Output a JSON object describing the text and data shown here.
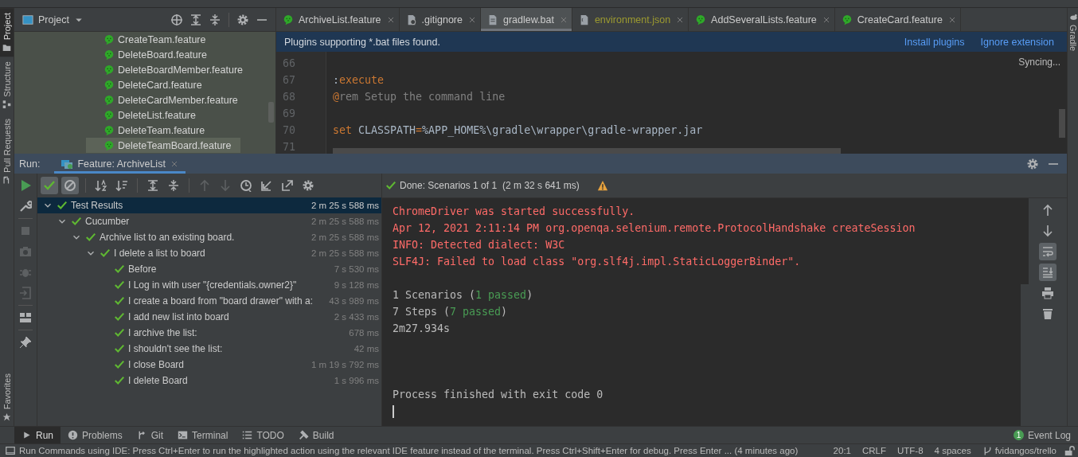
{
  "left_tool_strip": [
    {
      "label": "Project",
      "selected": true
    },
    {
      "label": "Structure",
      "selected": false
    },
    {
      "label": "Pull Requests",
      "selected": false
    },
    {
      "label": "Favorites",
      "selected": false
    }
  ],
  "project_panel": {
    "title": "Project",
    "items": [
      {
        "label": "CreateTeam.feature",
        "selected": false
      },
      {
        "label": "DeleteBoard.feature",
        "selected": false
      },
      {
        "label": "DeleteBoardMember.feature",
        "selected": false
      },
      {
        "label": "DeleteCard.feature",
        "selected": false
      },
      {
        "label": "DeleteCardMember.feature",
        "selected": false
      },
      {
        "label": "DeleteList.feature",
        "selected": false
      },
      {
        "label": "DeleteTeam.feature",
        "selected": false
      },
      {
        "label": "DeleteTeamBoard.feature",
        "selected": true
      }
    ]
  },
  "editor_tabs": [
    {
      "label": "ArchiveList.feature",
      "kind": "cucumber",
      "selected": false,
      "modified": false
    },
    {
      "label": ".gitignore",
      "kind": "ignore",
      "selected": false,
      "modified": false
    },
    {
      "label": "gradlew.bat",
      "kind": "file",
      "selected": true,
      "modified": false
    },
    {
      "label": "environment.json",
      "kind": "json",
      "selected": false,
      "modified": true
    },
    {
      "label": "AddSeveralLists.feature",
      "kind": "cucumber",
      "selected": false,
      "modified": false
    },
    {
      "label": "CreateCard.feature",
      "kind": "cucumber",
      "selected": false,
      "modified": false
    }
  ],
  "notification": {
    "text": "Plugins supporting *.bat files found.",
    "actions": [
      "Install plugins",
      "Ignore extension"
    ]
  },
  "right_tool_strip": {
    "label": "Gradle"
  },
  "editor": {
    "status": "Syncing...",
    "lines": [
      {
        "number": "66"
      },
      {
        "number": "67",
        "code": [
          {
            "text": ":",
            "kind": "plain"
          },
          {
            "text": "execute",
            "kind": "keyword"
          }
        ]
      },
      {
        "number": "68",
        "code": [
          {
            "text": "@",
            "kind": "keyword"
          },
          {
            "text": "rem Setup the command line",
            "kind": "comment"
          }
        ]
      },
      {
        "number": "69"
      },
      {
        "number": "70",
        "code": [
          {
            "text": "set",
            "kind": "keyword"
          },
          {
            "text": " CLASSPATH",
            "kind": "plain"
          },
          {
            "text": "=",
            "kind": "keyword"
          },
          {
            "text": "%APP_HOME%\\gradle\\wrapper\\gradle-wrapper.jar",
            "kind": "plain"
          }
        ]
      },
      {
        "number": "71"
      }
    ]
  },
  "run_panel": {
    "label": "Run:",
    "tabs": [
      {
        "label": "Feature: ArchiveList",
        "selected": true
      }
    ],
    "tree_toggles": [
      {
        "kind": "passed",
        "selected": true
      },
      {
        "kind": "ignored",
        "selected": true
      }
    ],
    "status": {
      "text": "Done: Scenarios 1 of 1",
      "duration": "(2 m 32 s 641 ms)",
      "warning": true
    },
    "tree": [
      {
        "label": "Test Results",
        "duration": "2 m 25 s 588 ms",
        "passed": true,
        "expanded": true,
        "selected": true,
        "children": [
          {
            "label": "Cucumber",
            "duration": "2 m 25 s 588 ms",
            "passed": true,
            "expanded": true,
            "selected": false,
            "children": [
              {
                "label": "Archive list to an existing board.",
                "duration": "2 m 25 s 588 ms",
                "passed": true,
                "expanded": true,
                "selected": false,
                "children": [
                  {
                    "label": "I delete a list to board",
                    "duration": "2 m 25 s 588 ms",
                    "passed": true,
                    "expanded": true,
                    "selected": false,
                    "children": [
                      {
                        "label": "Before",
                        "duration": "7 s 530 ms",
                        "passed": true,
                        "selected": false
                      },
                      {
                        "label": "I Log in with user \"{credentials.owner2}\"",
                        "duration": "9 s 128 ms",
                        "passed": true,
                        "selected": false
                      },
                      {
                        "label": "I create a board from \"board drawer\" with a:",
                        "duration": "43 s 989 ms",
                        "passed": true,
                        "selected": false
                      },
                      {
                        "label": "I add new list into board",
                        "duration": "2 s 433 ms",
                        "passed": true,
                        "selected": false
                      },
                      {
                        "label": "I archive the list:",
                        "duration": "678 ms",
                        "passed": true,
                        "selected": false
                      },
                      {
                        "label": "I shouldn't see the list:",
                        "duration": "42 ms",
                        "passed": true,
                        "selected": false
                      },
                      {
                        "label": "I close Board",
                        "duration": "1 m 19 s 792 ms",
                        "passed": true,
                        "selected": false
                      },
                      {
                        "label": "I delete Board",
                        "duration": "1 s 996 ms",
                        "passed": true,
                        "selected": false
                      }
                    ]
                  }
                ]
              }
            ]
          }
        ]
      }
    ],
    "console": [
      {
        "lines": [
          {
            "parts": [
              {
                "text": "ChromeDriver was started successfully.",
                "kind": "error"
              }
            ]
          },
          {
            "parts": [
              {
                "text": "Apr 12, 2021 2:11:14 PM org.openqa.selenium.remote.ProtocolHandshake createSession",
                "kind": "error"
              }
            ]
          },
          {
            "parts": [
              {
                "text": "INFO: Detected dialect: W3C",
                "kind": "error"
              }
            ]
          },
          {
            "parts": [
              {
                "text": "SLF4J: Failed to load class \"org.slf4j.impl.StaticLoggerBinder\".",
                "kind": "error"
              }
            ]
          }
        ]
      },
      {
        "lines": [
          {
            "parts": [
              {
                "text": "1 Scenarios (",
                "kind": "normal"
              },
              {
                "text": "1 passed",
                "kind": "passed"
              },
              {
                "text": ")",
                "kind": "normal"
              }
            ]
          },
          {
            "parts": [
              {
                "text": "7 Steps (",
                "kind": "normal"
              },
              {
                "text": "7 passed",
                "kind": "passed"
              },
              {
                "text": ")",
                "kind": "normal"
              }
            ]
          },
          {
            "parts": [
              {
                "text": "2m27.934s",
                "kind": "normal"
              }
            ]
          }
        ]
      },
      {
        "lines": [
          {
            "parts": [
              {
                "text": "Process finished with exit code 0",
                "kind": "normal"
              }
            ]
          }
        ]
      }
    ],
    "console_toggles": [
      {
        "kind": "wrap",
        "selected": true
      },
      {
        "kind": "scroll",
        "selected": true
      }
    ]
  },
  "bottom_tabs": [
    {
      "label": "Run",
      "kind": "run",
      "selected": true
    },
    {
      "label": "Problems",
      "kind": "problems",
      "selected": false
    },
    {
      "label": "Git",
      "kind": "git",
      "selected": false
    },
    {
      "label": "Terminal",
      "kind": "terminal",
      "selected": false
    },
    {
      "label": "TODO",
      "kind": "todo",
      "selected": false
    },
    {
      "label": "Build",
      "kind": "build",
      "selected": false
    }
  ],
  "event_log": {
    "label": "Event Log",
    "count": "1"
  },
  "status_bar": {
    "message": "Run Commands using IDE: Press Ctrl+Enter to run the highlighted action using the relevant IDE feature instead of the terminal. Press Ctrl+Shift+Enter for debug. Press Enter ... (4 minutes ago)",
    "items": [
      "20:1",
      "CRLF",
      "UTF-8",
      "4 spaces"
    ],
    "branch": "fvidangos/trello"
  }
}
